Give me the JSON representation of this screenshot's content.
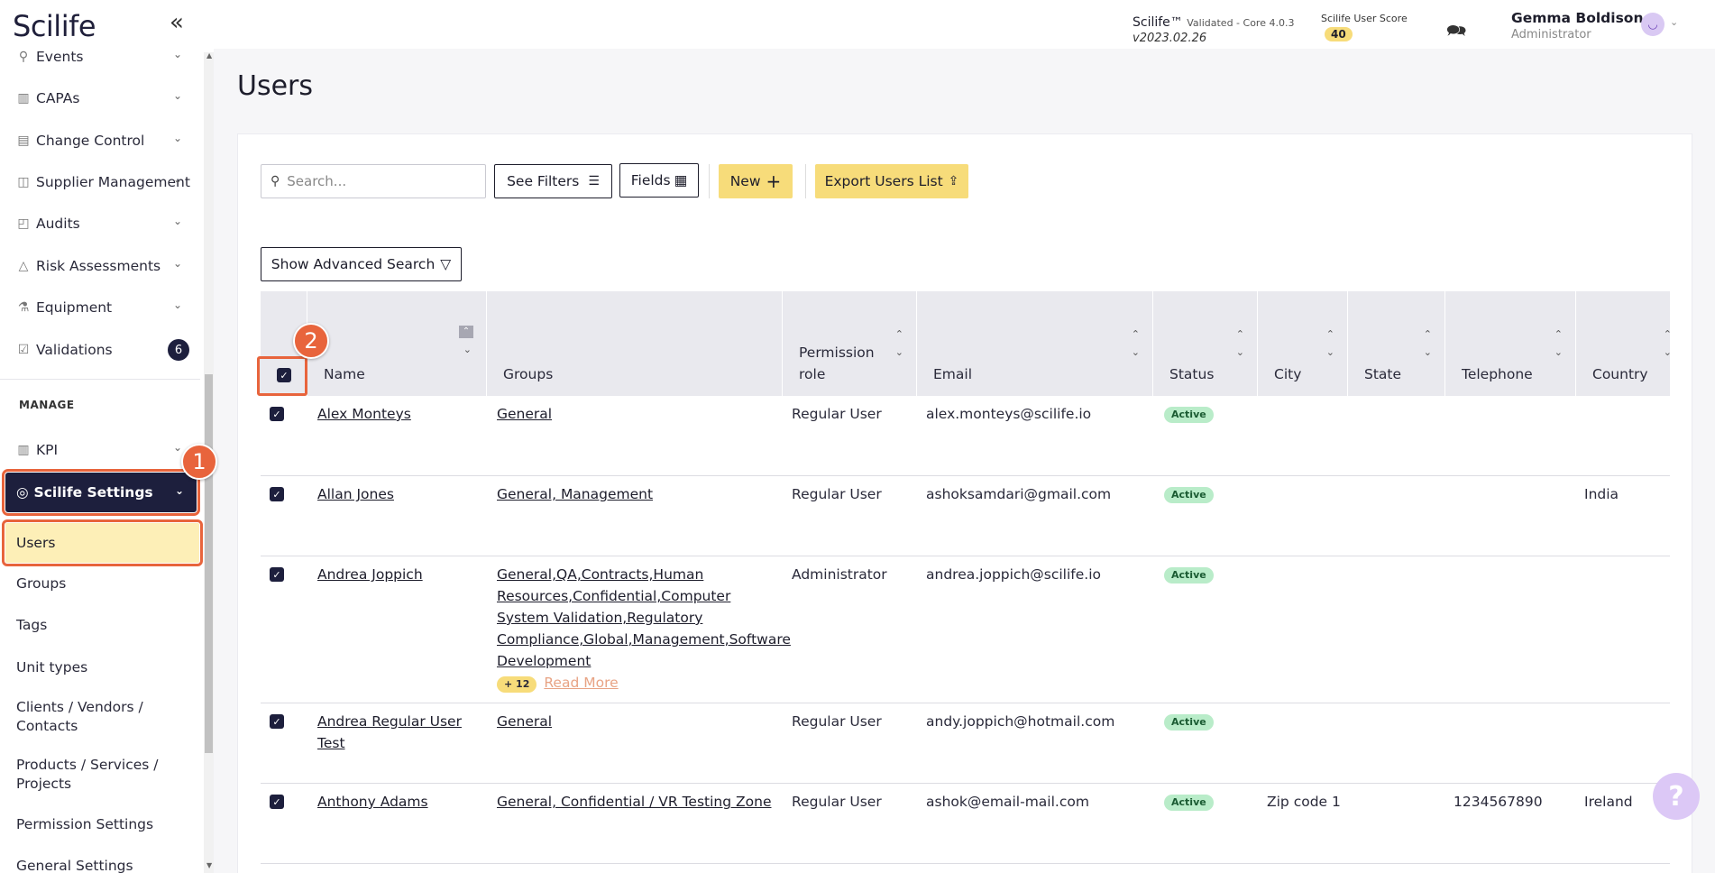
{
  "app": {
    "logo": "Scilife",
    "version": "Scilife™",
    "version_note": "Validated - Core 4.0.3",
    "version_date": "v2023.02.26",
    "score_label": "Scilife User Score",
    "score": "40",
    "user_name": "Gemma Boldison",
    "user_role": "Administrator"
  },
  "sidebar": {
    "items": [
      {
        "label": "Events"
      },
      {
        "label": "CAPAs"
      },
      {
        "label": "Change Control"
      },
      {
        "label": "Supplier Management"
      },
      {
        "label": "Audits"
      },
      {
        "label": "Risk Assessments"
      },
      {
        "label": "Equipment"
      },
      {
        "label": "Validations",
        "badge": "6"
      }
    ],
    "section": "MANAGE",
    "kpi": "KPI",
    "settings": "Scilife Settings",
    "sub_items": [
      {
        "label": "Users"
      },
      {
        "label": "Groups"
      },
      {
        "label": "Tags"
      },
      {
        "label": "Unit types"
      },
      {
        "label": "Clients / Vendors / Contacts"
      },
      {
        "label": "Products / Services / Projects"
      },
      {
        "label": "Permission Settings"
      },
      {
        "label": "General Settings"
      }
    ]
  },
  "callouts": [
    "1",
    "2"
  ],
  "main": {
    "title": "Users",
    "search_placeholder": "Search...",
    "see_filters": "See Filters",
    "fields": "Fields",
    "new": "New",
    "export": "Export Users List",
    "advanced_search": "Show Advanced Search"
  },
  "table": {
    "columns": [
      "Name",
      "Groups",
      "Permission role",
      "Email",
      "Status",
      "City",
      "State",
      "Telephone",
      "Country"
    ],
    "rows": [
      {
        "name": "Alex Monteys",
        "groups": "General",
        "role": "Regular User",
        "email": "alex.monteys@scilife.io",
        "status": "Active",
        "city": "",
        "state": "",
        "telephone": "",
        "country": ""
      },
      {
        "name": "Allan Jones",
        "groups": "General, Management",
        "role": "Regular User",
        "email": "ashoksamdari@gmail.com",
        "status": "Active",
        "city": "",
        "state": "",
        "telephone": "",
        "country": "India"
      },
      {
        "name": "Andrea Joppich",
        "groups": "General,QA,Contracts,Human Resources,Confidential,Computer System Validation,Regulatory Compliance,Global,Management,Software Development",
        "more_count": "+ 12",
        "read_more": "Read More",
        "role": "Administrator",
        "email": "andrea.joppich@scilife.io",
        "status": "Active",
        "city": "",
        "state": "",
        "telephone": "",
        "country": ""
      },
      {
        "name": "Andrea Regular User Test",
        "groups": "General",
        "role": "Regular User",
        "email": "andy.joppich@hotmail.com",
        "status": "Active",
        "city": "",
        "state": "",
        "telephone": "",
        "country": ""
      },
      {
        "name": "Anthony Adams",
        "groups": "General, Confidential / VR Testing Zone",
        "role": "Regular User",
        "email": "ashok@email-mail.com",
        "status": "Active",
        "city": "Zip code 1",
        "state": "",
        "telephone": "1234567890",
        "country": "Ireland"
      }
    ]
  },
  "help": "?"
}
